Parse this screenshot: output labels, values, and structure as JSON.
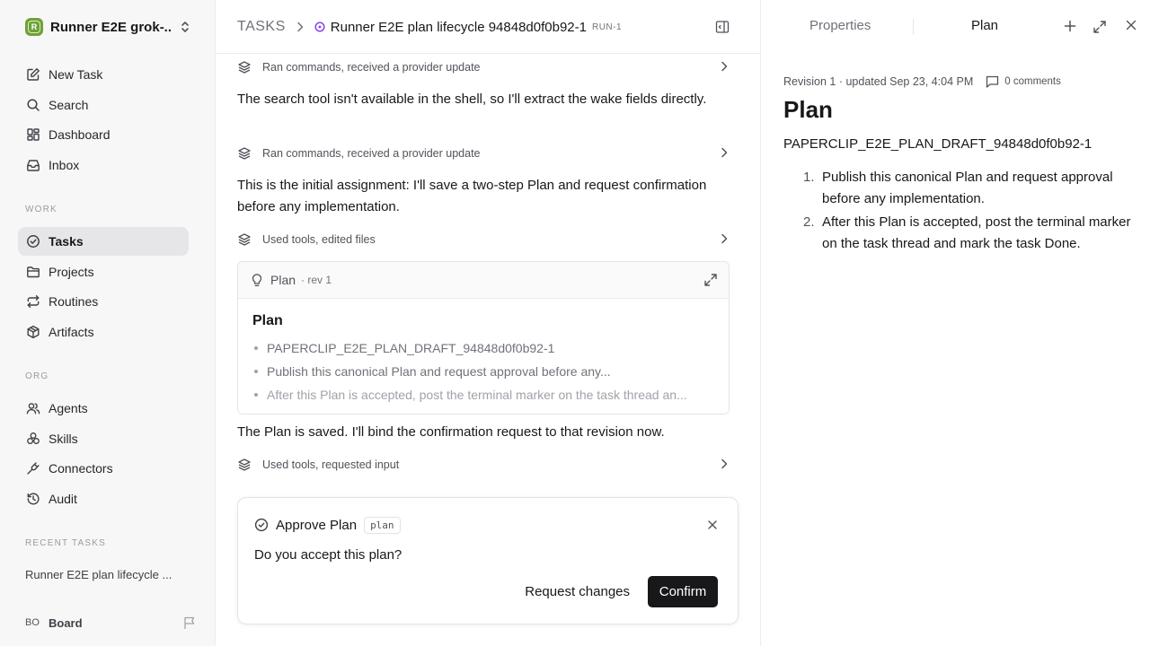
{
  "sidebar": {
    "workspace": {
      "initial": "R",
      "name": "Runner E2E grok-..."
    },
    "nav_top": [
      {
        "label": "New Task",
        "icon": "edit-icon"
      },
      {
        "label": "Search",
        "icon": "search-icon"
      },
      {
        "label": "Dashboard",
        "icon": "dashboard-icon"
      },
      {
        "label": "Inbox",
        "icon": "inbox-icon"
      }
    ],
    "section_work": "WORK",
    "nav_work": [
      {
        "label": "Tasks",
        "icon": "check-circle-icon",
        "active": true
      },
      {
        "label": "Projects",
        "icon": "folder-icon"
      },
      {
        "label": "Routines",
        "icon": "repeat-icon"
      },
      {
        "label": "Artifacts",
        "icon": "box-icon"
      }
    ],
    "section_org": "ORG",
    "nav_org": [
      {
        "label": "Agents",
        "icon": "users-icon"
      },
      {
        "label": "Skills",
        "icon": "skills-icon"
      },
      {
        "label": "Connectors",
        "icon": "plug-icon"
      },
      {
        "label": "Audit",
        "icon": "history-icon"
      }
    ],
    "section_recent": "RECENT TASKS",
    "recent_tasks": [
      "Runner E2E plan lifecycle ..."
    ],
    "board": {
      "avatar": "BO",
      "label": "Board"
    }
  },
  "header": {
    "root": "TASKS",
    "task_title": "Runner E2E plan lifecycle 94848d0f0b92-1",
    "task_id": "RUN-1"
  },
  "thread": {
    "activity_1": "Ran commands, received a provider update",
    "message_1": "The search tool isn't available in the shell, so I'll extract the wake fields directly.",
    "activity_2": "Ran commands, received a provider update",
    "message_2": "This is the initial assignment: I'll save a two-step Plan and request confirmation before any implementation.",
    "activity_3": "Used tools, edited files",
    "plan_card": {
      "label": "Plan",
      "rev": "· rev 1",
      "title": "Plan",
      "items": [
        "PAPERCLIP_E2E_PLAN_DRAFT_94848d0f0b92-1",
        "Publish this canonical Plan and request approval before any...",
        "After this Plan is accepted, post the terminal marker on the task thread an..."
      ]
    },
    "message_3": "The Plan is saved. I'll bind the confirmation request to that revision now.",
    "activity_4": "Used tools, requested input"
  },
  "approval": {
    "title": "Approve Plan",
    "tag": "plan",
    "question": "Do you accept this plan?",
    "request_changes_label": "Request changes",
    "confirm_label": "Confirm"
  },
  "right_panel": {
    "tabs": {
      "properties": "Properties",
      "plan": "Plan"
    },
    "revision_line": "Revision 1 · updated Sep 23, 4:04 PM",
    "comments": "0 comments",
    "title": "Plan",
    "draft_id": "PAPERCLIP_E2E_PLAN_DRAFT_94848d0f0b92-1",
    "steps": [
      {
        "num": "1.",
        "text": "Publish this canonical Plan and request approval before any implementation."
      },
      {
        "num": "2.",
        "text": "After this Plan is accepted, post the terminal marker on the task thread and mark the task Done."
      }
    ]
  },
  "colors": {
    "accent_dark": "#18181b",
    "workspace_logo": "#6fa03a",
    "sidebar_bg": "#f7f7f8",
    "status_purple": "#7c3aed"
  }
}
